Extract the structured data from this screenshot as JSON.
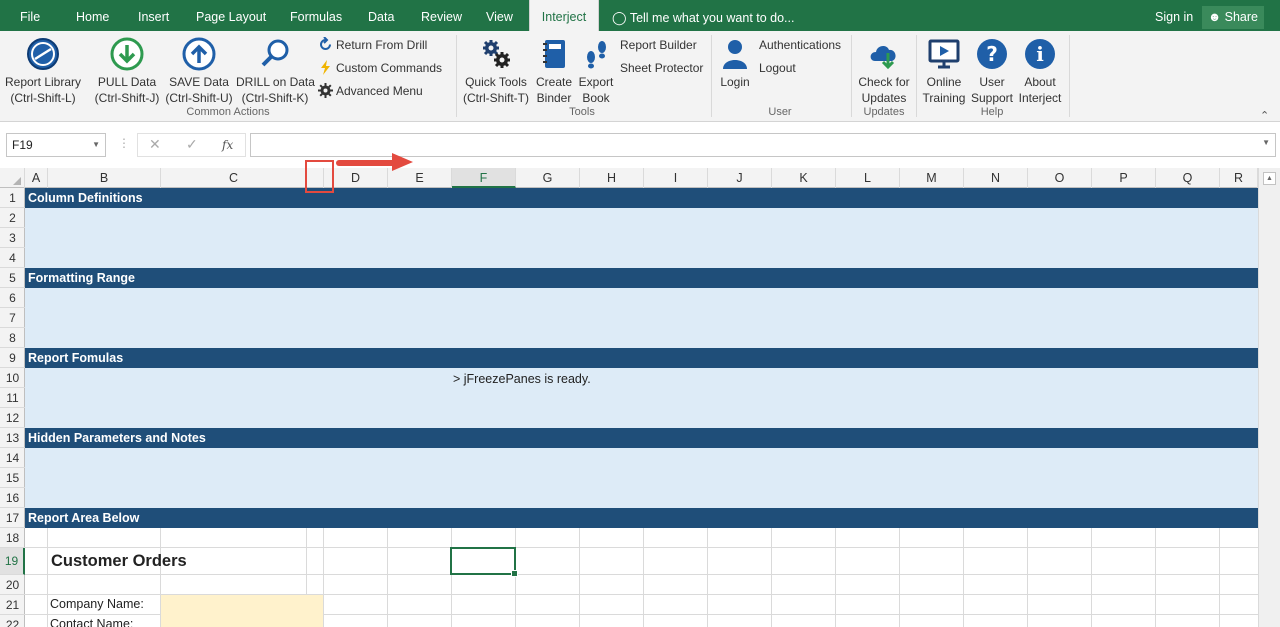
{
  "menu": {
    "tabs": [
      "File",
      "Home",
      "Insert",
      "Page Layout",
      "Formulas",
      "Data",
      "Review",
      "View",
      "Interject"
    ],
    "active_tab": "Interject",
    "tell_me": "Tell me what you want to do...",
    "sign_in": "Sign in",
    "share": "Share"
  },
  "ribbon": {
    "common_actions": {
      "label": "Common Actions",
      "report_library": {
        "line1": "Report Library",
        "line2": "(Ctrl-Shift-L)"
      },
      "pull_data": {
        "line1": "PULL Data",
        "line2": "(Ctrl-Shift-J)"
      },
      "save_data": {
        "line1": "SAVE Data",
        "line2": "(Ctrl-Shift-U)"
      },
      "drill_data": {
        "line1": "DRILL on Data",
        "line2": "(Ctrl-Shift-K)"
      },
      "return_from_drill": "Return From Drill",
      "custom_commands": "Custom Commands",
      "advanced_menu": "Advanced Menu"
    },
    "tools": {
      "label": "Tools",
      "quick_tools": {
        "line1": "Quick Tools",
        "line2": "(Ctrl-Shift-T)"
      },
      "create_binder": {
        "line1": "Create",
        "line2": "Binder"
      },
      "export_book": {
        "line1": "Export",
        "line2": "Book"
      },
      "report_builder": "Report Builder",
      "sheet_protector": "Sheet Protector"
    },
    "user": {
      "label": "User",
      "login": "Login",
      "authentications": "Authentications",
      "logout": "Logout"
    },
    "updates": {
      "label": "Updates",
      "check": {
        "line1": "Check for",
        "line2": "Updates"
      }
    },
    "help": {
      "label": "Help",
      "online_training": {
        "line1": "Online",
        "line2": "Training"
      },
      "user_support": {
        "line1": "User",
        "line2": "Support"
      },
      "about": {
        "line1": "About",
        "line2": "Interject"
      }
    }
  },
  "formula_bar": {
    "name_box": "F19",
    "fx": "fx",
    "cancel": "✕",
    "enter": "✓",
    "content": ""
  },
  "columns": [
    "A",
    "B",
    "C",
    "",
    "D",
    "E",
    "F",
    "G",
    "H",
    "I",
    "J",
    "K",
    "L",
    "M",
    "N",
    "O",
    "P",
    "Q",
    "R"
  ],
  "selected_column": "F",
  "rows": [
    "1",
    "2",
    "3",
    "4",
    "5",
    "6",
    "7",
    "8",
    "9",
    "10",
    "11",
    "12",
    "13",
    "14",
    "15",
    "16",
    "17",
    "18",
    "19",
    "20",
    "21",
    "22"
  ],
  "selected_row": "19",
  "sheet": {
    "section_headers": [
      "Column Definitions",
      "Formatting Range",
      "Report Fomulas",
      "Hidden Parameters and Notes",
      "Report Area Below"
    ],
    "freeze_message": "> jFreezePanes is ready.",
    "title": "Customer Orders",
    "company_label": "Company Name:",
    "contact_label": "Contact Name:"
  },
  "colors": {
    "excel_green": "#217346",
    "section_header": "#1f4e79",
    "section_fill": "#ddebf7",
    "input_fill": "#fff2cc",
    "annotation_red": "#e34a3f"
  }
}
